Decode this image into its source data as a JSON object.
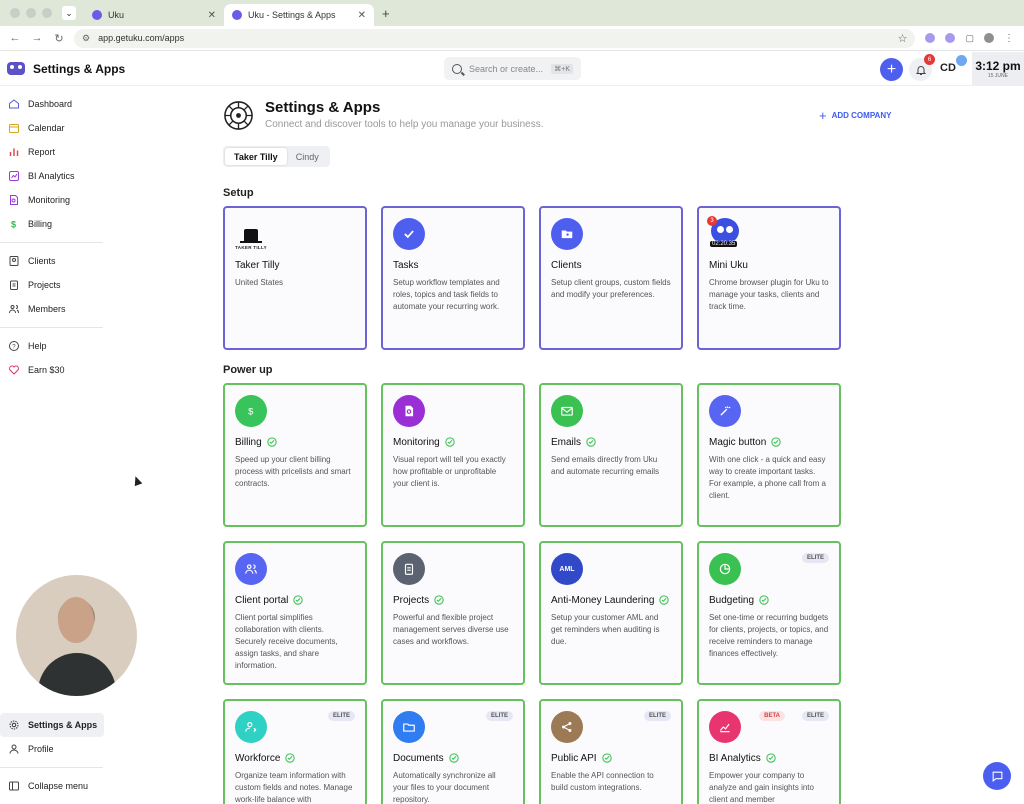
{
  "browser": {
    "tabs": [
      {
        "label": "Uku"
      },
      {
        "label": "Uku - Settings & Apps"
      }
    ],
    "url": "app.getuku.com/apps"
  },
  "header": {
    "title": "Settings & Apps",
    "search_placeholder": "Search or create...",
    "search_shortcut": "⌘+K",
    "notification_count": "6",
    "user_initials": "CD",
    "time": "3:12 pm",
    "date": "15 JUNE"
  },
  "sidebar": {
    "items": [
      {
        "label": "Dashboard",
        "icon": "home-icon"
      },
      {
        "label": "Calendar",
        "icon": "calendar-icon"
      },
      {
        "label": "Report",
        "icon": "bar-chart-icon"
      },
      {
        "label": "BI Analytics",
        "icon": "bi-analytics-icon"
      },
      {
        "label": "Monitoring",
        "icon": "monitoring-icon"
      },
      {
        "label": "Billing",
        "icon": "dollar-icon"
      },
      {
        "label": "Clients",
        "icon": "clients-icon"
      },
      {
        "label": "Projects",
        "icon": "projects-icon"
      },
      {
        "label": "Members",
        "icon": "members-icon"
      },
      {
        "label": "Help",
        "icon": "help-icon"
      },
      {
        "label": "Earn $30",
        "icon": "heart-icon"
      }
    ],
    "bottom": [
      {
        "label": "Settings & Apps",
        "icon": "gear-icon"
      },
      {
        "label": "Profile",
        "icon": "user-icon"
      },
      {
        "label": "Collapse menu",
        "icon": "collapse-icon"
      }
    ]
  },
  "page": {
    "title": "Settings & Apps",
    "subtitle": "Connect and discover tools to help you manage your business.",
    "add_company": "ADD COMPANY",
    "company_tabs": [
      "Taker Tilly",
      "Cindy"
    ],
    "active_company": "Taker Tilly"
  },
  "sections": {
    "setup": {
      "title": "Setup",
      "cards": [
        {
          "title": "Taker Tilly",
          "desc": "United States",
          "logo_text": "TAKER TILLY"
        },
        {
          "title": "Tasks",
          "desc": "Setup workflow templates and roles, topics and task fields to automate your recurring work."
        },
        {
          "title": "Clients",
          "desc": "Setup client groups, custom fields and modify your preferences."
        },
        {
          "title": "Mini Uku",
          "desc": "Chrome browser plugin for Uku to manage your tasks, clients and track time.",
          "badge": "3",
          "timer": "02:20:35"
        }
      ]
    },
    "powerup": {
      "title": "Power up",
      "cards": [
        {
          "title": "Billing",
          "desc": "Speed up your client billing process with pricelists and smart contracts."
        },
        {
          "title": "Monitoring",
          "desc": "Visual report will tell you exactly how profitable or unprofitable your client is."
        },
        {
          "title": "Emails",
          "desc": "Send emails directly from Uku and automate recurring emails"
        },
        {
          "title": "Magic button",
          "desc": "With one click - a quick and easy way to create important tasks. For example, a phone call from a client."
        },
        {
          "title": "Client portal",
          "desc": "Client portal simplifies collaboration with clients. Securely receive documents, assign tasks, and share information."
        },
        {
          "title": "Projects",
          "desc": "Powerful and flexible project management serves diverse use cases and workflows."
        },
        {
          "title": "Anti-Money Laundering",
          "desc": "Setup your customer AML and get reminders when auditing is due.",
          "icon_text": "AML"
        },
        {
          "title": "Budgeting",
          "desc": "Set one-time or recurring budgets for clients, projects, or topics, and receive reminders to manage finances effectively.",
          "tag": "ELITE"
        },
        {
          "title": "Workforce",
          "desc": "Organize team information with custom fields and notes. Manage work-life balance with",
          "tag": "ELITE"
        },
        {
          "title": "Documents",
          "desc": "Automatically synchronize all your files to your document repository.",
          "tag": "ELITE"
        },
        {
          "title": "Public API",
          "desc": "Enable the API connection to build custom integrations.",
          "tag": "ELITE"
        },
        {
          "title": "BI Analytics",
          "desc": "Empower your company to analyze and gain insights into client and member",
          "tag": "ELITE",
          "tag2": "BETA"
        }
      ]
    }
  },
  "colors": {
    "accent": "#4e5ff0",
    "setup_border": "#6d63d6",
    "powerup_border": "#66c25e",
    "billing": "#38c45a",
    "monitoring": "#9b2fd6",
    "emails": "#3ac152",
    "magic": "#5865f2",
    "client_portal": "#5865f2",
    "projects": "#5b6272",
    "aml": "#3149c9",
    "budgeting": "#3ac152",
    "workforce": "#2ed1c4",
    "documents": "#2f7df0",
    "public_api": "#9b7a55",
    "bi_analytics": "#e8356f"
  }
}
